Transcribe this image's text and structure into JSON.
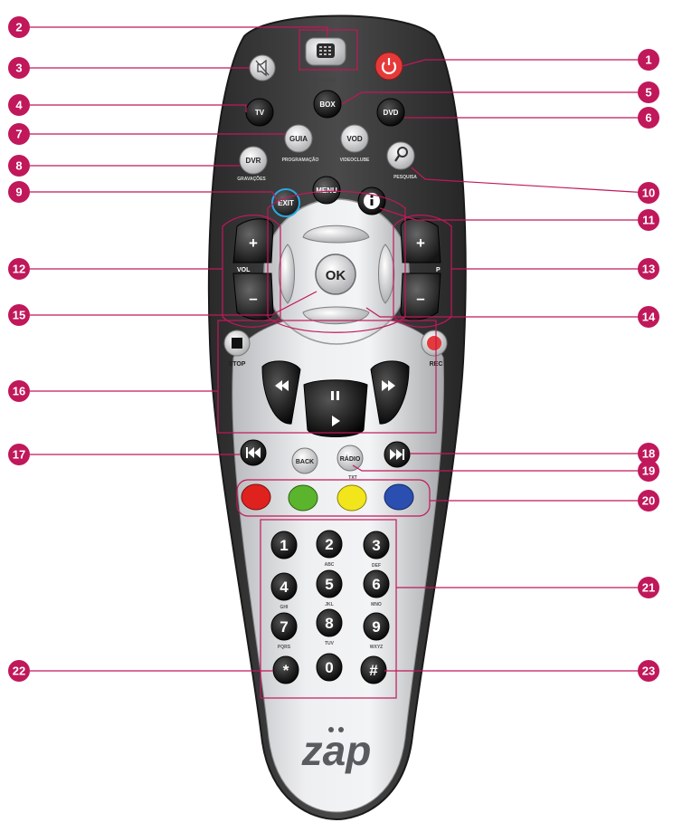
{
  "buttons": {
    "mosaico": "MOSAICO",
    "tv": "TV",
    "box": "BOX",
    "dvd": "DVD",
    "guia": "GUIA",
    "guia_sub": "PROGRAMAÇÃO",
    "vod": "VOD",
    "vod_sub": "VIDEOCLUBE",
    "dvr": "DVR",
    "dvr_sub": "GRAVAÇÕES",
    "pesquisa": "PESQUISA",
    "exit": "EXIT",
    "menu": "MENU",
    "ok": "OK",
    "vol": "VOL",
    "p": "P",
    "stop": "STOP",
    "rec": "REC",
    "back": "BACK",
    "radio": "RÁDIO",
    "radio_sub": "TXT"
  },
  "keypad": [
    {
      "digit": "1",
      "letters": ""
    },
    {
      "digit": "2",
      "letters": "ABC"
    },
    {
      "digit": "3",
      "letters": "DEF"
    },
    {
      "digit": "4",
      "letters": "GHI"
    },
    {
      "digit": "5",
      "letters": "JKL"
    },
    {
      "digit": "6",
      "letters": "MNO"
    },
    {
      "digit": "7",
      "letters": "PQRS"
    },
    {
      "digit": "8",
      "letters": "TUV"
    },
    {
      "digit": "9",
      "letters": "WXYZ"
    },
    {
      "digit": "*",
      "letters": ""
    },
    {
      "digit": "0",
      "letters": ""
    },
    {
      "digit": "#",
      "letters": ""
    }
  ],
  "brand": "zap",
  "callouts": [
    "1",
    "2",
    "3",
    "4",
    "5",
    "6",
    "7",
    "8",
    "9",
    "10",
    "11",
    "12",
    "13",
    "14",
    "15",
    "16",
    "17",
    "18",
    "19",
    "20",
    "21",
    "22",
    "23"
  ],
  "colors": {
    "callout": "#c0185a",
    "body_dark": "#3d3d3d",
    "body_silver": "#d9dadc",
    "power": "#e53a3a",
    "rec": "#e53a3a",
    "red_key": "#e0221f",
    "green_key": "#5ab52c",
    "yellow_key": "#f2e51c",
    "blue_key": "#2a4fb0"
  }
}
